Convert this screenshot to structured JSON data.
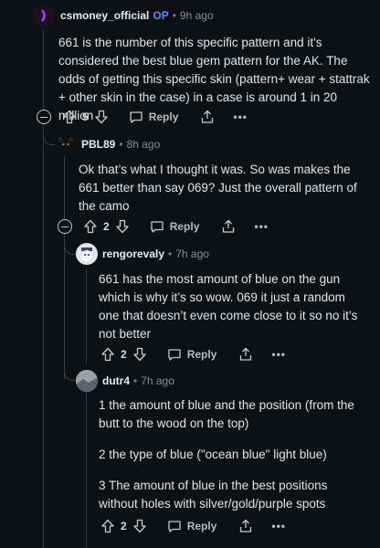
{
  "comments": [
    {
      "author": "csmoney_official",
      "badge": "OP",
      "time": "9h ago",
      "body": [
        "661 is the number of this specific pattern and it's considered the best blue gem pattern for the AK. The odds of getting this specific skin (pattern+ wear + stattrak + other skin in the case) in a case is around 1 in 20 million"
      ],
      "votes": "5",
      "reply_label": "Reply"
    },
    {
      "author": "PBL89",
      "time": "8h ago",
      "body": [
        "Ok that’s what I thought it was. So was makes the 661 better than say 069? Just the overall pattern of the camo"
      ],
      "votes": "2",
      "reply_label": "Reply"
    },
    {
      "author": "rengorevaly",
      "time": "7h ago",
      "body": [
        "661 has the most amount of blue on the gun which is why it’s so wow. 069 it just a random one that doesn’t even come close to it so no it’s not better"
      ],
      "votes": "2",
      "reply_label": "Reply"
    },
    {
      "author": "dutr4",
      "time": "7h ago",
      "body": [
        "1 the amount of blue and the position (from the butt to the wood on the top)",
        "2 the type of blue (\"ocean blue\" light blue)",
        "3 The amount of blue in the best positions without holes with silver/gold/purple spots"
      ],
      "votes": "2",
      "reply_label": "Reply"
    }
  ],
  "separator": "•",
  "more_label": "•••",
  "colors": {
    "background": "#0e1113",
    "op_badge": "#5a8bff",
    "thread_line": "#3a3d40"
  }
}
